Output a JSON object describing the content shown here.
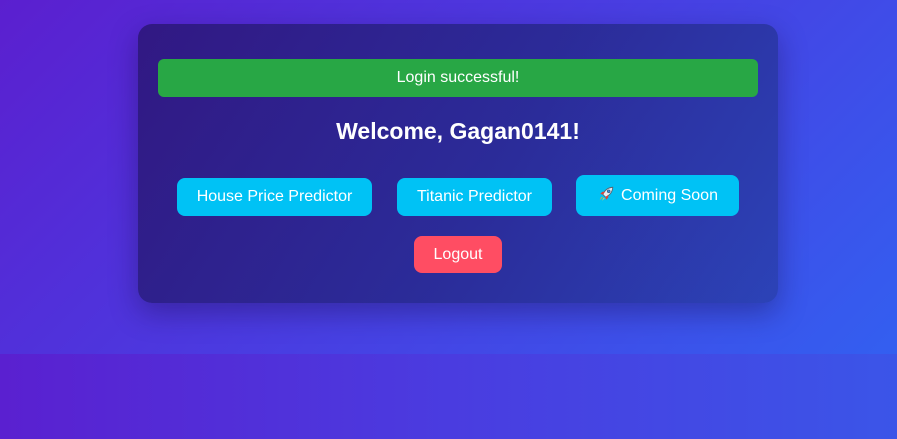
{
  "flash": {
    "message": "Login successful!"
  },
  "welcome": {
    "heading": "Welcome, Gagan0141!"
  },
  "buttons": {
    "house_price": "House Price Predictor",
    "titanic": "Titanic Predictor",
    "coming_soon": "Coming Soon",
    "coming_soon_icon": "rocket-icon",
    "logout": "Logout"
  },
  "colors": {
    "flash_bg": "#28a745",
    "primary_button": "#00c2f5",
    "logout_button": "#ff4d63"
  }
}
